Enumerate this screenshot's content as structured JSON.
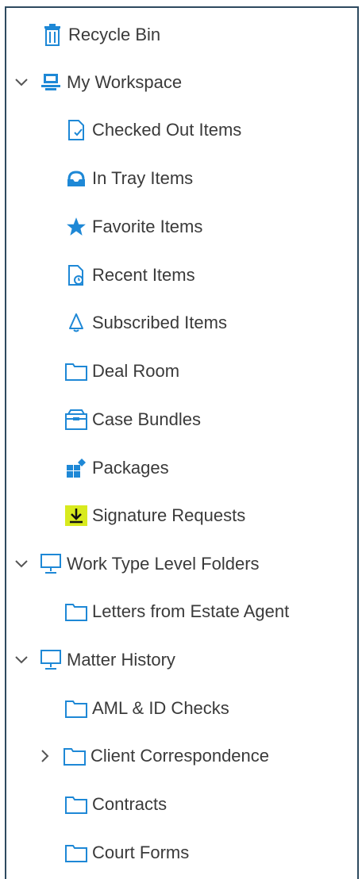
{
  "colors": {
    "icon_blue": "#1e88d6",
    "border": "#2e4a5f",
    "highlight": "#d8ea1e",
    "text": "#3a3a3a"
  },
  "tree": {
    "recycle_bin": "Recycle Bin",
    "my_workspace": "My Workspace",
    "checked_out": "Checked Out Items",
    "in_tray": "In Tray Items",
    "favorite": "Favorite Items",
    "recent": "Recent Items",
    "subscribed": "Subscribed Items",
    "deal_room": "Deal Room",
    "case_bundles": "Case Bundles",
    "packages": "Packages",
    "signature_requests": "Signature Requests",
    "work_type_level_folders": "Work Type Level Folders",
    "letters_from_estate_agent": "Letters from Estate Agent",
    "matter_history": "Matter History",
    "aml_id_checks": "AML & ID Checks",
    "client_correspondence": "Client Correspondence",
    "contracts": "Contracts",
    "court_forms": "Court Forms"
  }
}
